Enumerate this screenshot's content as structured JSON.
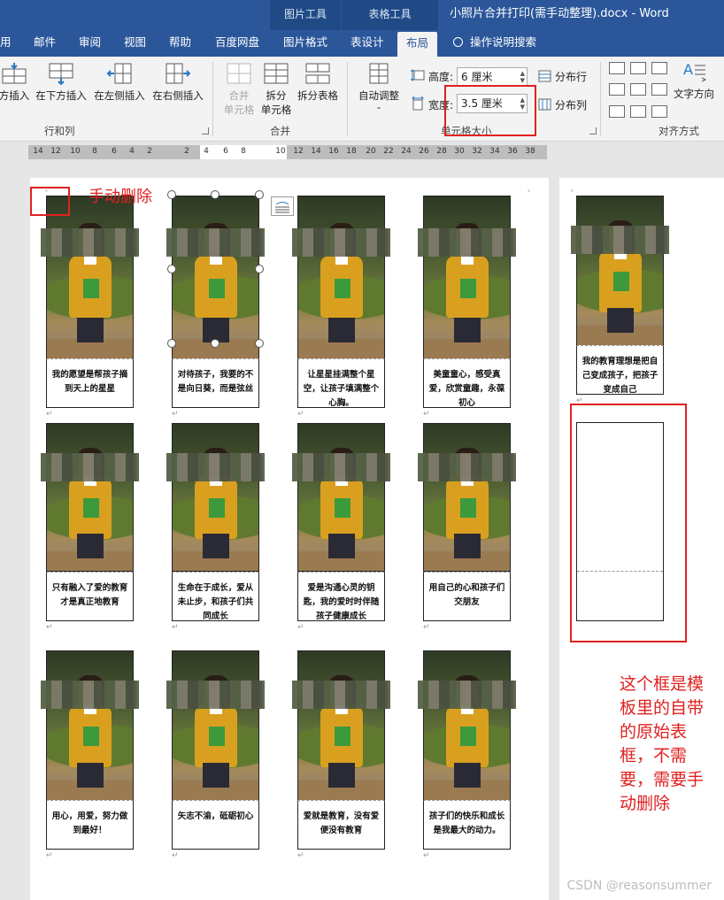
{
  "window": {
    "doc_title": "小照片合并打印(需手动整理).docx  -  Word",
    "context_tabs": {
      "picture_tools": "图片工具",
      "table_tools": "表格工具"
    }
  },
  "ribbon_tabs": [
    {
      "label": "用"
    },
    {
      "label": "邮件"
    },
    {
      "label": "审阅"
    },
    {
      "label": "视图"
    },
    {
      "label": "帮助"
    },
    {
      "label": "百度网盘"
    },
    {
      "label": "图片格式"
    },
    {
      "label": "表设计"
    },
    {
      "label": "布局"
    },
    {
      "label": "操作说明搜索"
    }
  ],
  "ribbon": {
    "rows_cols": {
      "buttons": [
        "方插入",
        "在下方插入",
        "在左侧插入",
        "在右侧插入"
      ],
      "group_label": "行和列"
    },
    "merge": {
      "merge_cells": [
        "合并",
        "单元格"
      ],
      "split_cells": [
        "拆分",
        "单元格"
      ],
      "split_table": "拆分表格",
      "group_label": "合并"
    },
    "cell_size": {
      "autofit": "自动调整",
      "height_label": "高度:",
      "height_value": "6 厘米",
      "width_label": "宽度:",
      "width_value": "3.5 厘米",
      "distribute_rows": "分布行",
      "distribute_cols": "分布列",
      "group_label": "单元格大小"
    },
    "alignment": {
      "text_direction": "文字方向",
      "group_label": "对齐方式"
    }
  },
  "ruler_ticks": [
    "14",
    "12",
    "10",
    "8",
    "6",
    "4",
    "2",
    "",
    "2",
    "4",
    "6",
    "8",
    "",
    "10",
    "12",
    "14",
    "16",
    "18",
    "20",
    "22",
    "24",
    "26",
    "28",
    "30",
    "32",
    "34",
    "36",
    "38",
    "40"
  ],
  "captions": [
    "我的愿望是帮孩子摘到天上的星星",
    "对待孩子，我要的不是向日葵，而是弦丝",
    "让星星挂满整个星空，让孩子填满整个心胸。",
    "美童童心，感受真爱，欣赏童趣，永葆初心",
    "我的教育理想是把自己变成孩子，把孩子变成自己",
    "只有融入了爱的教育才是真正地教育",
    "生命在于成长，爱从未止步，和孩子们共同成长",
    "爱是沟通心灵的钥匙，我的爱时时伴随孩子健康成长",
    "用自己的心和孩子们交朋友",
    "用心，用爱，努力做到最好！",
    "矢志不渝，砥砺初心",
    "爱就是教育，没有爱便没有教育",
    "孩子们的快乐和成长是我最大的动力。"
  ],
  "annotations": {
    "manual_delete": "手动删除",
    "template_box_note": [
      "这个框是模",
      "板里的自带",
      "的原始表",
      "框，不需",
      "要，需要手",
      "动删除"
    ]
  },
  "watermark": "CSDN @reasonsummer",
  "colors": {
    "title_bar": "#2b579a",
    "ribbon_bg": "#f3f3f3",
    "annotation_red": "#e02020"
  }
}
